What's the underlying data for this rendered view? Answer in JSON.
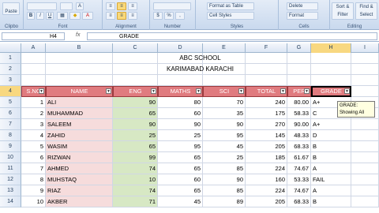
{
  "ribbon": {
    "clipboard_label": "Clipbo",
    "paste_label": "Paste",
    "font_label": "Font",
    "alignment_label": "Alignment",
    "number_label": "Number",
    "styles_label": "Styles",
    "cells_label": "Cells",
    "editing_label": "Editing",
    "format_table": "Format as Table",
    "cell_styles": "Cell Styles",
    "delete": "Delete",
    "format": "Format",
    "sort_filter": "Sort & Filter",
    "find_select": "Find & Select",
    "percent": "%",
    "comma": ","
  },
  "formula_bar": {
    "name_box": "H4",
    "fx": "fx",
    "value": "GRADE"
  },
  "columns": [
    "A",
    "B",
    "C",
    "D",
    "E",
    "F",
    "G",
    "H",
    "I"
  ],
  "rows": [
    "1",
    "2",
    "3",
    "4",
    "5",
    "6",
    "7",
    "8",
    "9",
    "10",
    "11",
    "12",
    "13",
    "14"
  ],
  "title1": "ABC SCHOOL",
  "title2": "KARIMABAD KARACHI",
  "headers": [
    "S.NO",
    "NAME",
    "ENG",
    "MATHS",
    "SCI",
    "TOTAL",
    "PER",
    "GRADE"
  ],
  "data": [
    [
      "1",
      "ALI",
      "90",
      "80",
      "70",
      "240",
      "80.00",
      "A+"
    ],
    [
      "2",
      "MUHAMMAD",
      "65",
      "60",
      "35",
      "175",
      "58.33",
      "C"
    ],
    [
      "3",
      "SALEEM",
      "90",
      "90",
      "90",
      "270",
      "90.00",
      "A+"
    ],
    [
      "4",
      "ZAHID",
      "25",
      "25",
      "95",
      "145",
      "48.33",
      "D"
    ],
    [
      "5",
      "WASIM",
      "65",
      "95",
      "45",
      "205",
      "68.33",
      "B"
    ],
    [
      "6",
      "RIZWAN",
      "99",
      "65",
      "25",
      "185",
      "61.67",
      "B"
    ],
    [
      "7",
      "AHMED",
      "74",
      "65",
      "85",
      "224",
      "74.67",
      "A"
    ],
    [
      "8",
      "MUHSTAQ",
      "10",
      "60",
      "90",
      "160",
      "53.33",
      "FAIL"
    ],
    [
      "9",
      "RIAZ",
      "74",
      "65",
      "85",
      "224",
      "74.67",
      "A"
    ],
    [
      "10",
      "AKBER",
      "71",
      "45",
      "89",
      "205",
      "68.33",
      "B"
    ]
  ],
  "tooltip": {
    "line1": "GRADE:",
    "line2": "Showing All"
  }
}
